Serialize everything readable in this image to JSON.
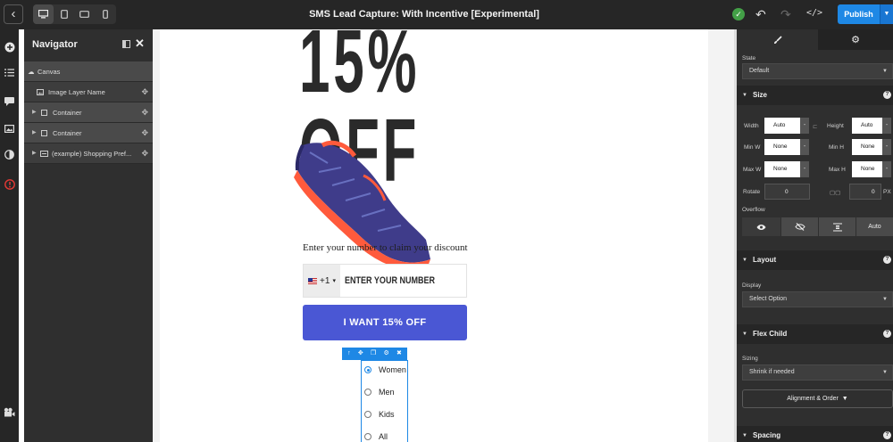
{
  "topbar": {
    "title": "SMS Lead Capture: With Incentive [Experimental]",
    "publish_label": "Publish",
    "code_label": "</>",
    "devices": [
      "desktop-icon",
      "tablet-icon",
      "tablet-landscape-icon",
      "mobile-icon"
    ]
  },
  "rail": {
    "icons": [
      "add-icon",
      "list-icon",
      "comments-icon",
      "media-icon",
      "contrast-icon",
      "alert-icon",
      "video-icon"
    ]
  },
  "navigator": {
    "title": "Navigator",
    "rows": [
      {
        "label": "Canvas"
      },
      {
        "label": "Image Layer Name"
      },
      {
        "label": "Container"
      },
      {
        "label": "Container"
      },
      {
        "label": "(example) Shopping Pref..."
      }
    ]
  },
  "canvas": {
    "headline_top": "15%",
    "headline_bottom": "OFF",
    "cta_text": "Enter your number to claim your discount",
    "phone": {
      "country_code": "+1",
      "placeholder": "ENTER YOUR NUMBER"
    },
    "offer_button": "I WANT 15% OFF",
    "radio_options": [
      "Women",
      "Men",
      "Kids",
      "All"
    ],
    "selected_option": "Women"
  },
  "panel": {
    "state": {
      "label": "State",
      "value": "Default"
    },
    "size": {
      "title": "Size",
      "width_label": "Width",
      "width_value": "Auto",
      "height_label": "Height",
      "height_value": "Auto",
      "min_w_label": "Min W",
      "min_w_value": "None",
      "min_h_label": "Min H",
      "min_h_value": "None",
      "max_w_label": "Max W",
      "max_w_value": "None",
      "max_h_label": "Max H",
      "max_h_value": "None",
      "rotate_label": "Rotate",
      "rotate_value": "0",
      "radius_value": "0",
      "radius_unit": "PX",
      "overflow_label": "Overflow",
      "overflow_auto": "Auto",
      "dash": "-"
    },
    "layout": {
      "title": "Layout",
      "display_label": "Display",
      "display_value": "Select Option"
    },
    "flex_child": {
      "title": "Flex Child",
      "sizing_label": "Sizing",
      "sizing_value": "Shrink if needed",
      "alignment_label": "Alignment & Order"
    },
    "spacing": {
      "title": "Spacing"
    },
    "help": "?"
  },
  "colors": {
    "accent": "#1e88e5",
    "offer_button": "#4a57d4",
    "shoe_body": "#3f3c8a",
    "shoe_sole": "#ff5a3c"
  }
}
